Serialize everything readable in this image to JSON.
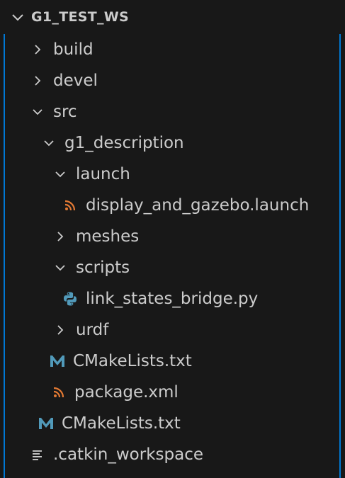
{
  "explorer": {
    "section_title": "G1_TEST_WS",
    "colors": {
      "background": "#181818",
      "text": "#cccccc",
      "focus_border": "#0078d4",
      "rss_icon": "#e37933",
      "markdown_icon": "#519aba",
      "python_icon": "#519aba"
    },
    "items": [
      {
        "label": "build",
        "kind": "folder",
        "expanded": false,
        "depth": 0
      },
      {
        "label": "devel",
        "kind": "folder",
        "expanded": false,
        "depth": 0
      },
      {
        "label": "src",
        "kind": "folder",
        "expanded": true,
        "depth": 0
      },
      {
        "label": "g1_description",
        "kind": "folder",
        "expanded": true,
        "depth": 1
      },
      {
        "label": "launch",
        "kind": "folder",
        "expanded": true,
        "depth": 2
      },
      {
        "label": "display_and_gazebo.launch",
        "kind": "file",
        "icon": "rss-icon",
        "depth": 3
      },
      {
        "label": "meshes",
        "kind": "folder",
        "expanded": false,
        "depth": 2
      },
      {
        "label": "scripts",
        "kind": "folder",
        "expanded": true,
        "depth": 2
      },
      {
        "label": "link_states_bridge.py",
        "kind": "file",
        "icon": "python-icon",
        "depth": 3
      },
      {
        "label": "urdf",
        "kind": "folder",
        "expanded": false,
        "depth": 2
      },
      {
        "label": "CMakeLists.txt",
        "kind": "file",
        "icon": "markdown-m-icon",
        "depth": 2
      },
      {
        "label": "package.xml",
        "kind": "file",
        "icon": "rss-icon",
        "depth": 2
      },
      {
        "label": "CMakeLists.txt",
        "kind": "file",
        "icon": "markdown-m-icon",
        "depth": 1
      },
      {
        "label": ".catkin_workspace",
        "kind": "file",
        "icon": "lines-icon",
        "depth": 0
      }
    ]
  }
}
